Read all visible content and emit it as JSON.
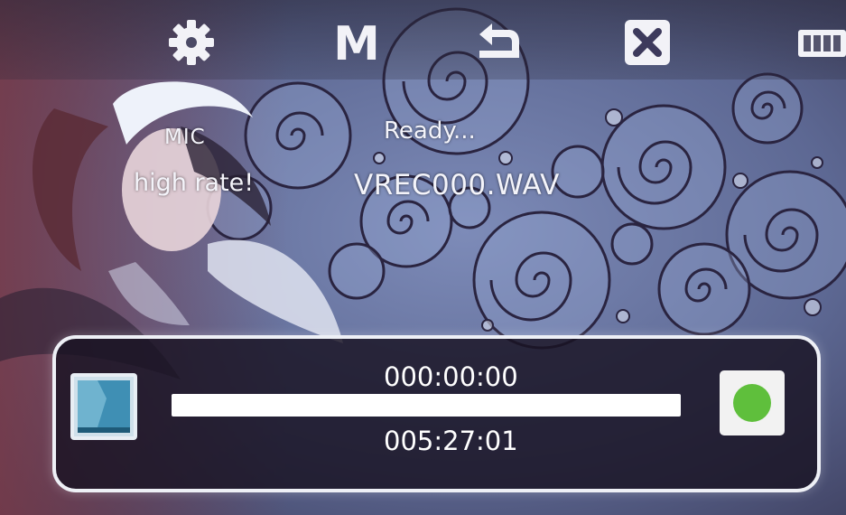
{
  "toolbar": {
    "settings_icon": "gear-icon",
    "menu_label": "M",
    "back_icon": "return-arrow-icon",
    "close_icon": "close-icon",
    "battery_icon": "battery-icon"
  },
  "recorder": {
    "source": "MIC",
    "quality": "high rate!",
    "status": "Ready...",
    "filename": "VREC000.WAV",
    "elapsed": "000:00:00",
    "remaining": "005:27:01",
    "progress_fraction": 1.0,
    "record_icon": "record-icon",
    "left_icon": "folder-icon"
  },
  "colors": {
    "record_green": "#5fbf3c",
    "panel_border": "#eef0f6",
    "text": "#ffffff"
  }
}
